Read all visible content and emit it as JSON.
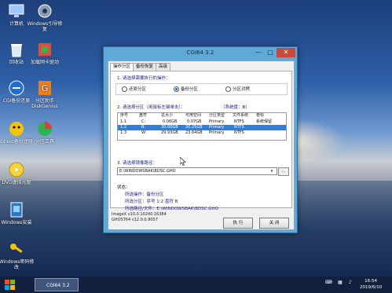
{
  "desktop": {
    "icons": [
      {
        "label": "计算机",
        "icon": "computer-icon"
      },
      {
        "label": "Windows引导修复",
        "icon": "gear-icon"
      },
      {
        "label": "回收站",
        "icon": "recycle-bin-icon"
      },
      {
        "label": "加载网卡驱动",
        "icon": "network-driver-icon"
      },
      {
        "label": "CGI备份还原",
        "icon": "cgi-backup-icon"
      },
      {
        "label": "分区助手DiskGenius",
        "icon": "diskgenius-icon"
      },
      {
        "label": "Ghost备份还原",
        "icon": "ghost-icon"
      },
      {
        "label": "分区工具",
        "icon": "partition-tool-icon"
      },
      {
        "label": "DVD虚拟光驱",
        "icon": "dvd-drive-icon"
      },
      {
        "label": "Windows安装",
        "icon": "windows-setup-icon"
      },
      {
        "label": "Windows密码修改",
        "icon": "key-icon"
      }
    ]
  },
  "window": {
    "title": "CGI64 3.2",
    "minimize": "—",
    "maximize": "□",
    "close": "✕",
    "tabs": [
      "操作分区",
      "备份恢复",
      "高级"
    ],
    "step1_label": "1. 请选择需要执行的操作：",
    "modes": [
      {
        "label": "还原分区",
        "selected": false
      },
      {
        "label": "备份分区",
        "selected": true
      },
      {
        "label": "分区对拷",
        "selected": false
      }
    ],
    "step2_label": "2. 请选择分区（用鼠标左键单击）：",
    "disk_info": "（系统盘：B）",
    "table": {
      "headers": [
        "序号",
        "盘符",
        "总大小",
        "可用空间",
        "分区类型",
        "文件系统",
        "卷标"
      ],
      "rows": [
        [
          "1:1",
          "C:",
          "0.06GB",
          "0.07GB",
          "Primary",
          "NTFS",
          "系统保留"
        ],
        [
          "1:2",
          "B:",
          "30.00GB",
          "20.25GB",
          "Primary",
          "NTFS",
          ""
        ],
        [
          "1:3",
          "W:",
          "29.93GB",
          "23.64GB",
          "Primary",
          "NTFS",
          ""
        ]
      ],
      "selected_row": 1
    },
    "step3_label": "3. 请选择镜像路径：",
    "path_value": "E:\\WINDOWSBAK\\BDSC.GHO",
    "dropdown_arrow": "▾",
    "browse_label": "...",
    "status_title": "状态：",
    "status": {
      "op": "所选操作：备份分区",
      "part": "所选分区：序号 1:2    盘符 B",
      "path": "所选路径/文件：E:\\WINDOWSBAK\\BDSC.GHO"
    },
    "footer_line1": "ImageX v10.0.10240.16384",
    "footer_line2": "GHOST64 v12.0.0.8057",
    "execute_label": "执 行",
    "close_label": "关 闭"
  },
  "taskbar": {
    "active_task": "CGI64 3.2",
    "tray_icons": [
      "keyboard-icon",
      "network-icon",
      "volume-icon"
    ],
    "time": "16:54",
    "date": "2019/6/10"
  },
  "colors": {
    "window_frame": "#5ea9d8",
    "selection": "#2f7fd8",
    "close_button": "#c94a3b",
    "section_text": "#1a1a8a"
  }
}
